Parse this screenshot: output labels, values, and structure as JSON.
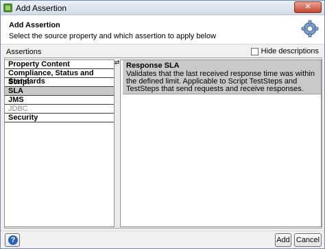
{
  "window": {
    "title": "Add Assertion",
    "close_label": "✕"
  },
  "header": {
    "title": "Add Assertion",
    "subtitle": "Select the source property and which assertion to apply below",
    "icon": "gear-icon"
  },
  "assertions": {
    "section_label": "Assertions",
    "hide_descriptions_label": "Hide descriptions",
    "hide_descriptions_checked": false,
    "categories": [
      {
        "label": "Property Content",
        "selected": false,
        "disabled": false
      },
      {
        "label": "Compliance, Status and Standards",
        "selected": false,
        "disabled": false
      },
      {
        "label": "Script",
        "selected": false,
        "disabled": false
      },
      {
        "label": "SLA",
        "selected": true,
        "disabled": false
      },
      {
        "label": "JMS",
        "selected": false,
        "disabled": false
      },
      {
        "label": "JDBC",
        "selected": false,
        "disabled": true
      },
      {
        "label": "Security",
        "selected": false,
        "disabled": false
      }
    ],
    "splitter_arrow": "⇄",
    "selected_assertion": {
      "title": "Response SLA",
      "description": "Validates that the last received response time was within the defined limit. Applicable to Script TestSteps and TestSteps that send requests and receive responses."
    }
  },
  "footer": {
    "help_label": "?",
    "add_label": "Add",
    "cancel_label": "Cancel"
  }
}
